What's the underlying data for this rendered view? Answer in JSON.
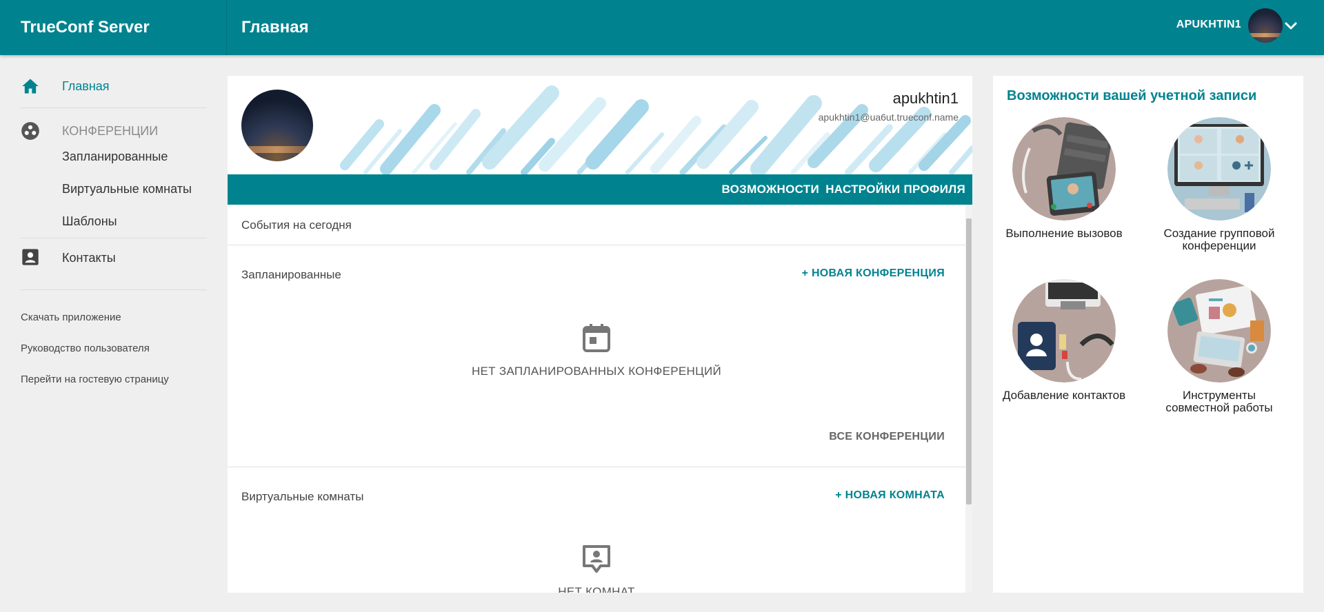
{
  "header": {
    "brand": "TrueConf Server",
    "title": "Главная",
    "user_name": "APUKHTIN1"
  },
  "sidebar": {
    "home_label": "Главная",
    "conferences_label": "КОНФЕРЕНЦИИ",
    "conf_items": [
      "Запланированные",
      "Виртуальные комнаты",
      "Шаблоны"
    ],
    "contacts_label": "Контакты",
    "links": [
      "Скачать приложение",
      "Руководство пользователя",
      "Перейти на гостевую страницу"
    ]
  },
  "profile": {
    "name": "apukhtin1",
    "email": "apukhtin1@ua6ut.trueconf.name",
    "tabs": [
      "ВОЗМОЖНОСТИ",
      "НАСТРОЙКИ ПРОФИЛЯ"
    ]
  },
  "content": {
    "today_title": "События на сегодня",
    "scheduled_title": "Запланированные",
    "new_conference": "+ НОВАЯ КОНФЕРЕНЦИЯ",
    "no_scheduled": "НЕТ ЗАПЛАНИРОВАННЫХ КОНФЕРЕНЦИЙ",
    "all_conferences": "ВСЕ КОНФЕРЕНЦИИ",
    "rooms_title": "Виртуальные комнаты",
    "new_room": "+ НОВАЯ КОМНАТА",
    "no_rooms": "НЕТ КОМНАТ"
  },
  "features": {
    "title": "Возможности вашей учетной записи",
    "items": [
      {
        "label": "Выполнение вызовов",
        "icon": "calls-illustration"
      },
      {
        "label": "Создание групповой конференции",
        "icon": "group-conference-illustration"
      },
      {
        "label": "Добавление контактов",
        "icon": "add-contacts-illustration"
      },
      {
        "label": "Инструменты совместной работы",
        "icon": "collaboration-tools-illustration"
      }
    ]
  },
  "colors": {
    "accent": "#00838f",
    "background": "#efefef"
  }
}
